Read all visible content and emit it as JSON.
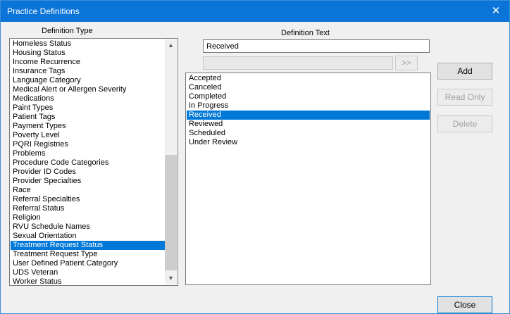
{
  "window": {
    "title": "Practice Definitions",
    "close_glyph": "✕"
  },
  "definition_type": {
    "label": "Definition Type",
    "items": [
      "Homeless Status",
      "Housing Status",
      "Income Recurrence",
      "Insurance Tags",
      "Language Category",
      "Medical Alert or Allergen Severity",
      "Medications",
      "Paint Types",
      "Patient Tags",
      "Payment Types",
      "Poverty Level",
      "PQRI Registries",
      "Problems",
      "Procedure Code Categories",
      "Provider ID Codes",
      "Provider Specialties",
      "Race",
      "Referral Specialties",
      "Referral Status",
      "Religion",
      "RVU Schedule Names",
      "Sexual Orientation",
      "Treatment Request Status",
      "Treatment Request Type",
      "User Defined Patient Category",
      "UDS Veteran",
      "Worker Status"
    ],
    "selected_index": 22,
    "scroll_up": "▲",
    "scroll_down": "▼"
  },
  "definition_text": {
    "label": "Definition Text",
    "value": "Received",
    "secondary_value": "",
    "move_button": ">>",
    "items": [
      "Accepted",
      "Canceled",
      "Completed",
      "In Progress",
      "Received",
      "Reviewed",
      "Scheduled",
      "Under Review"
    ],
    "selected_index": 4
  },
  "buttons": {
    "add": "Add",
    "read_only": "Read Only",
    "delete": "Delete",
    "close": "Close"
  }
}
